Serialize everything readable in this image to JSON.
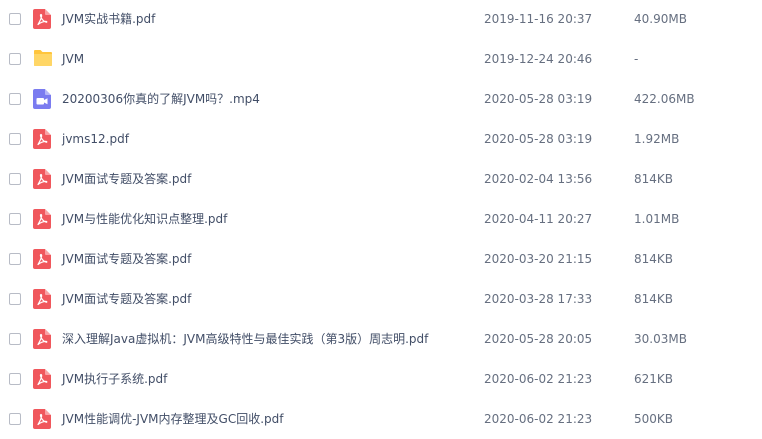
{
  "files": [
    {
      "name": "JVM实战书籍.pdf",
      "date": "2019-11-16 20:37",
      "size": "40.90MB",
      "icon": "pdf-icon"
    },
    {
      "name": "JVM",
      "date": "2019-12-24 20:46",
      "size": "-",
      "icon": "folder-icon"
    },
    {
      "name": "20200306你真的了解JVM吗？.mp4",
      "date": "2020-05-28 03:19",
      "size": "422.06MB",
      "icon": "video-icon"
    },
    {
      "name": "jvms12.pdf",
      "date": "2020-05-28 03:19",
      "size": "1.92MB",
      "icon": "pdf-icon"
    },
    {
      "name": "JVM面试专题及答案.pdf",
      "date": "2020-02-04 13:56",
      "size": "814KB",
      "icon": "pdf-icon"
    },
    {
      "name": "JVM与性能优化知识点整理.pdf",
      "date": "2020-04-11 20:27",
      "size": "1.01MB",
      "icon": "pdf-icon"
    },
    {
      "name": "JVM面试专题及答案.pdf",
      "date": "2020-03-20 21:15",
      "size": "814KB",
      "icon": "pdf-icon"
    },
    {
      "name": "JVM面试专题及答案.pdf",
      "date": "2020-03-28 17:33",
      "size": "814KB",
      "icon": "pdf-icon"
    },
    {
      "name": "深入理解Java虚拟机：JVM高级特性与最佳实践（第3版）周志明.pdf",
      "date": "2020-05-28 20:05",
      "size": "30.03MB",
      "icon": "pdf-icon"
    },
    {
      "name": "JVM执行子系统.pdf",
      "date": "2020-06-02 21:23",
      "size": "621KB",
      "icon": "pdf-icon"
    },
    {
      "name": "JVM性能调优-JVM内存整理及GC回收.pdf",
      "date": "2020-06-02 21:23",
      "size": "500KB",
      "icon": "pdf-icon"
    }
  ],
  "colors": {
    "pdf": "#f0575c",
    "folder": "#ffc53d",
    "video": "#7b7cf0",
    "checkbox_border": "#b8bcc6",
    "text": "#424e67",
    "meta_text": "#666f80"
  }
}
